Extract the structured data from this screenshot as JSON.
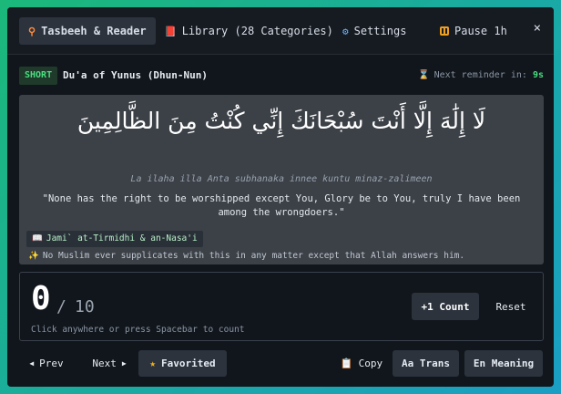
{
  "nav": {
    "tabs": [
      {
        "label": "Tasbeeh & Reader",
        "icon": "search-icon",
        "active": true
      },
      {
        "label": "Library (28 Categories)",
        "icon": "book-icon"
      },
      {
        "label": "Settings",
        "icon": "gear-icon"
      },
      {
        "label": "Pause 1h",
        "icon": "pause-icon"
      }
    ],
    "close_label": "×"
  },
  "info": {
    "badge": "SHORT",
    "title": "Du'a of Yunus (Dhun-Nun)",
    "reminder_label": "Next reminder in:",
    "reminder_value": "9s"
  },
  "reader": {
    "arabic": "لَا إِلَٰهَ إِلَّا أَنْتَ سُبْحَانَكَ إِنِّي كُنْتُ مِنَ الظَّالِمِينَ",
    "transliteration": "La ilaha illa Anta subhanaka innee kuntu minaz-zalimeen",
    "meaning": "\"None has the right to be worshipped except You, Glory be to You, truly I have been among the wrongdoers.\"",
    "source": "Jami` at-Tirmidhi & an-Nasa'i",
    "virtue": "No Muslim ever supplicates with this in any matter except that Allah answers him."
  },
  "counter": {
    "current": "0",
    "separator": "/",
    "target": "10",
    "hint": "Click anywhere or press Spacebar to count",
    "count_button": "+1 Count",
    "reset_button": "Reset"
  },
  "bottom": {
    "prev": "Prev",
    "next": "Next",
    "favorited": "Favorited",
    "copy": "Copy",
    "trans": "Aa Trans",
    "meaning": "En Meaning"
  },
  "colors": {
    "accent_green": "#4ade80",
    "background": "#11161c",
    "card": "#3c4148"
  }
}
